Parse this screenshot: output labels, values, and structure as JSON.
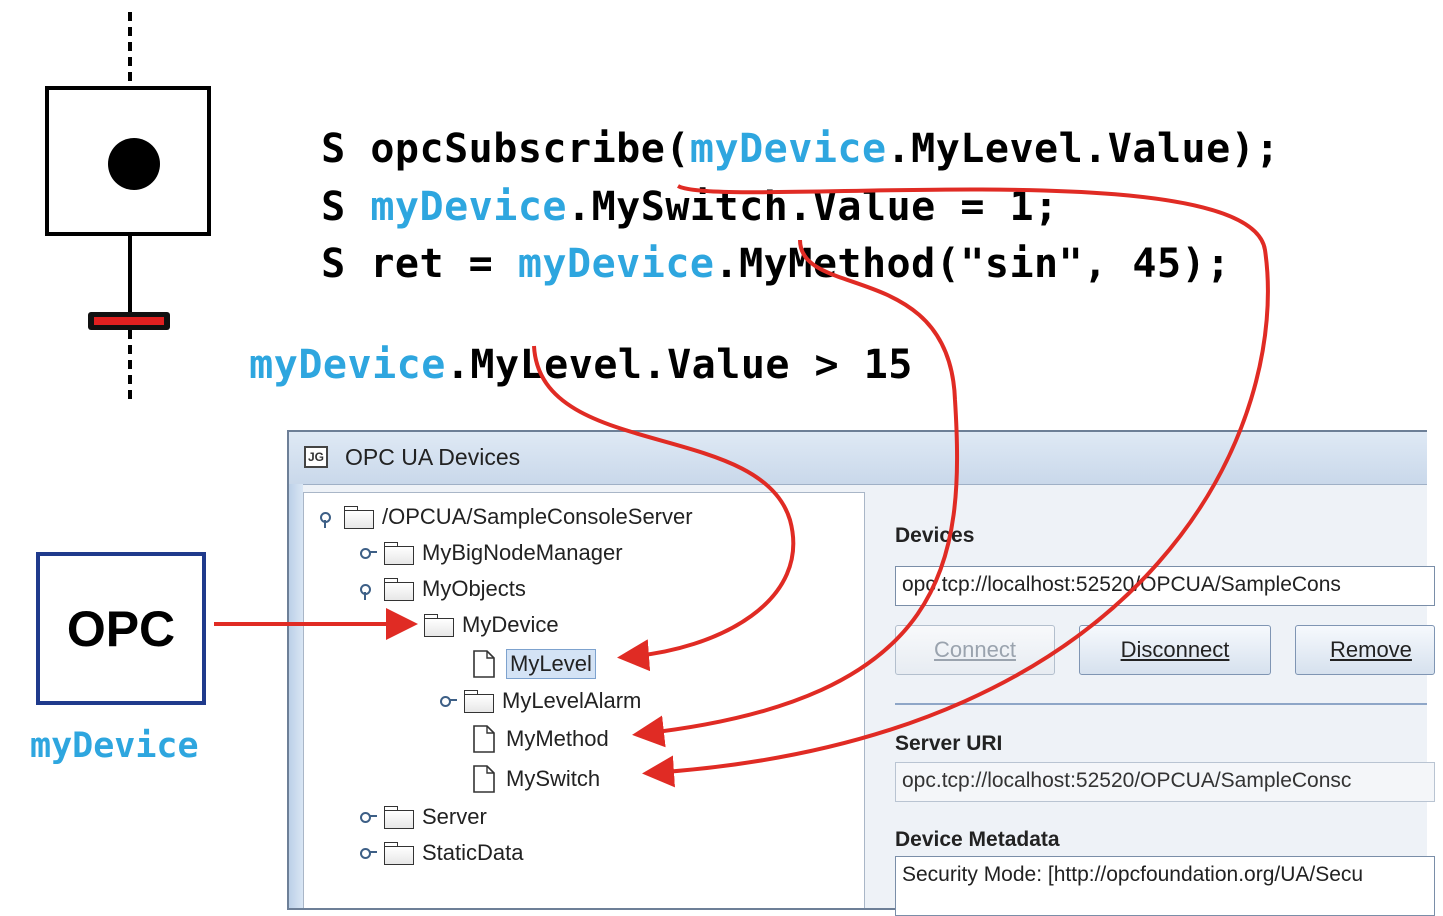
{
  "sfc": {
    "step_actions": [
      [
        {
          "t": "S opcSubscribe(",
          "v": false
        },
        {
          "t": "myDevice",
          "v": true
        },
        {
          "t": ".MyLevel.Value);",
          "v": false
        }
      ],
      [
        {
          "t": "S ",
          "v": false
        },
        {
          "t": "myDevice",
          "v": true
        },
        {
          "t": ".MySwitch.Value = 1;",
          "v": false
        }
      ],
      [
        {
          "t": "S ret = ",
          "v": false
        },
        {
          "t": "myDevice",
          "v": true
        },
        {
          "t": ".MyMethod(\"sin\", 45);",
          "v": false
        }
      ]
    ],
    "transition": {
      "var": "myDevice",
      "rest": ".MyLevel.Value > 15"
    }
  },
  "opc": {
    "label": "OPC",
    "caption": "myDevice"
  },
  "window": {
    "icon": "JG",
    "title": "OPC UA Devices",
    "tree": [
      {
        "label": "/OPCUA/SampleConsoleServer",
        "kind": "folder",
        "expanded": true
      },
      {
        "label": "MyBigNodeManager",
        "kind": "folder",
        "expanded": false
      },
      {
        "label": "MyObjects",
        "kind": "folder",
        "expanded": true
      },
      {
        "label": "MyDevice",
        "kind": "folder",
        "expanded": true
      },
      {
        "label": "MyLevel",
        "kind": "leaf",
        "selected": true
      },
      {
        "label": "MyLevelAlarm",
        "kind": "folder",
        "expanded": false
      },
      {
        "label": "MyMethod",
        "kind": "leaf"
      },
      {
        "label": "MySwitch",
        "kind": "leaf"
      },
      {
        "label": "Server",
        "kind": "folder",
        "expanded": false
      },
      {
        "label": "StaticData",
        "kind": "folder",
        "expanded": false
      }
    ],
    "devices_label": "Devices",
    "devices_value": "opc.tcp://localhost:52520/OPCUA/SampleCons",
    "buttons": {
      "connect": "Connect",
      "disconnect": "Disconnect",
      "remove": "Remove"
    },
    "server_uri_label": "Server URI",
    "server_uri_value": "opc.tcp://localhost:52520/OPCUA/SampleConsc",
    "metadata_label": "Device Metadata",
    "metadata_value": "Security Mode: [http://opcfoundation.org/UA/Secu"
  },
  "colors": {
    "variable": "#2ea6df",
    "arrow": "#e02b24",
    "step_line": "#000000",
    "transition": "#e02020",
    "opc_border": "#1f3a8c"
  }
}
